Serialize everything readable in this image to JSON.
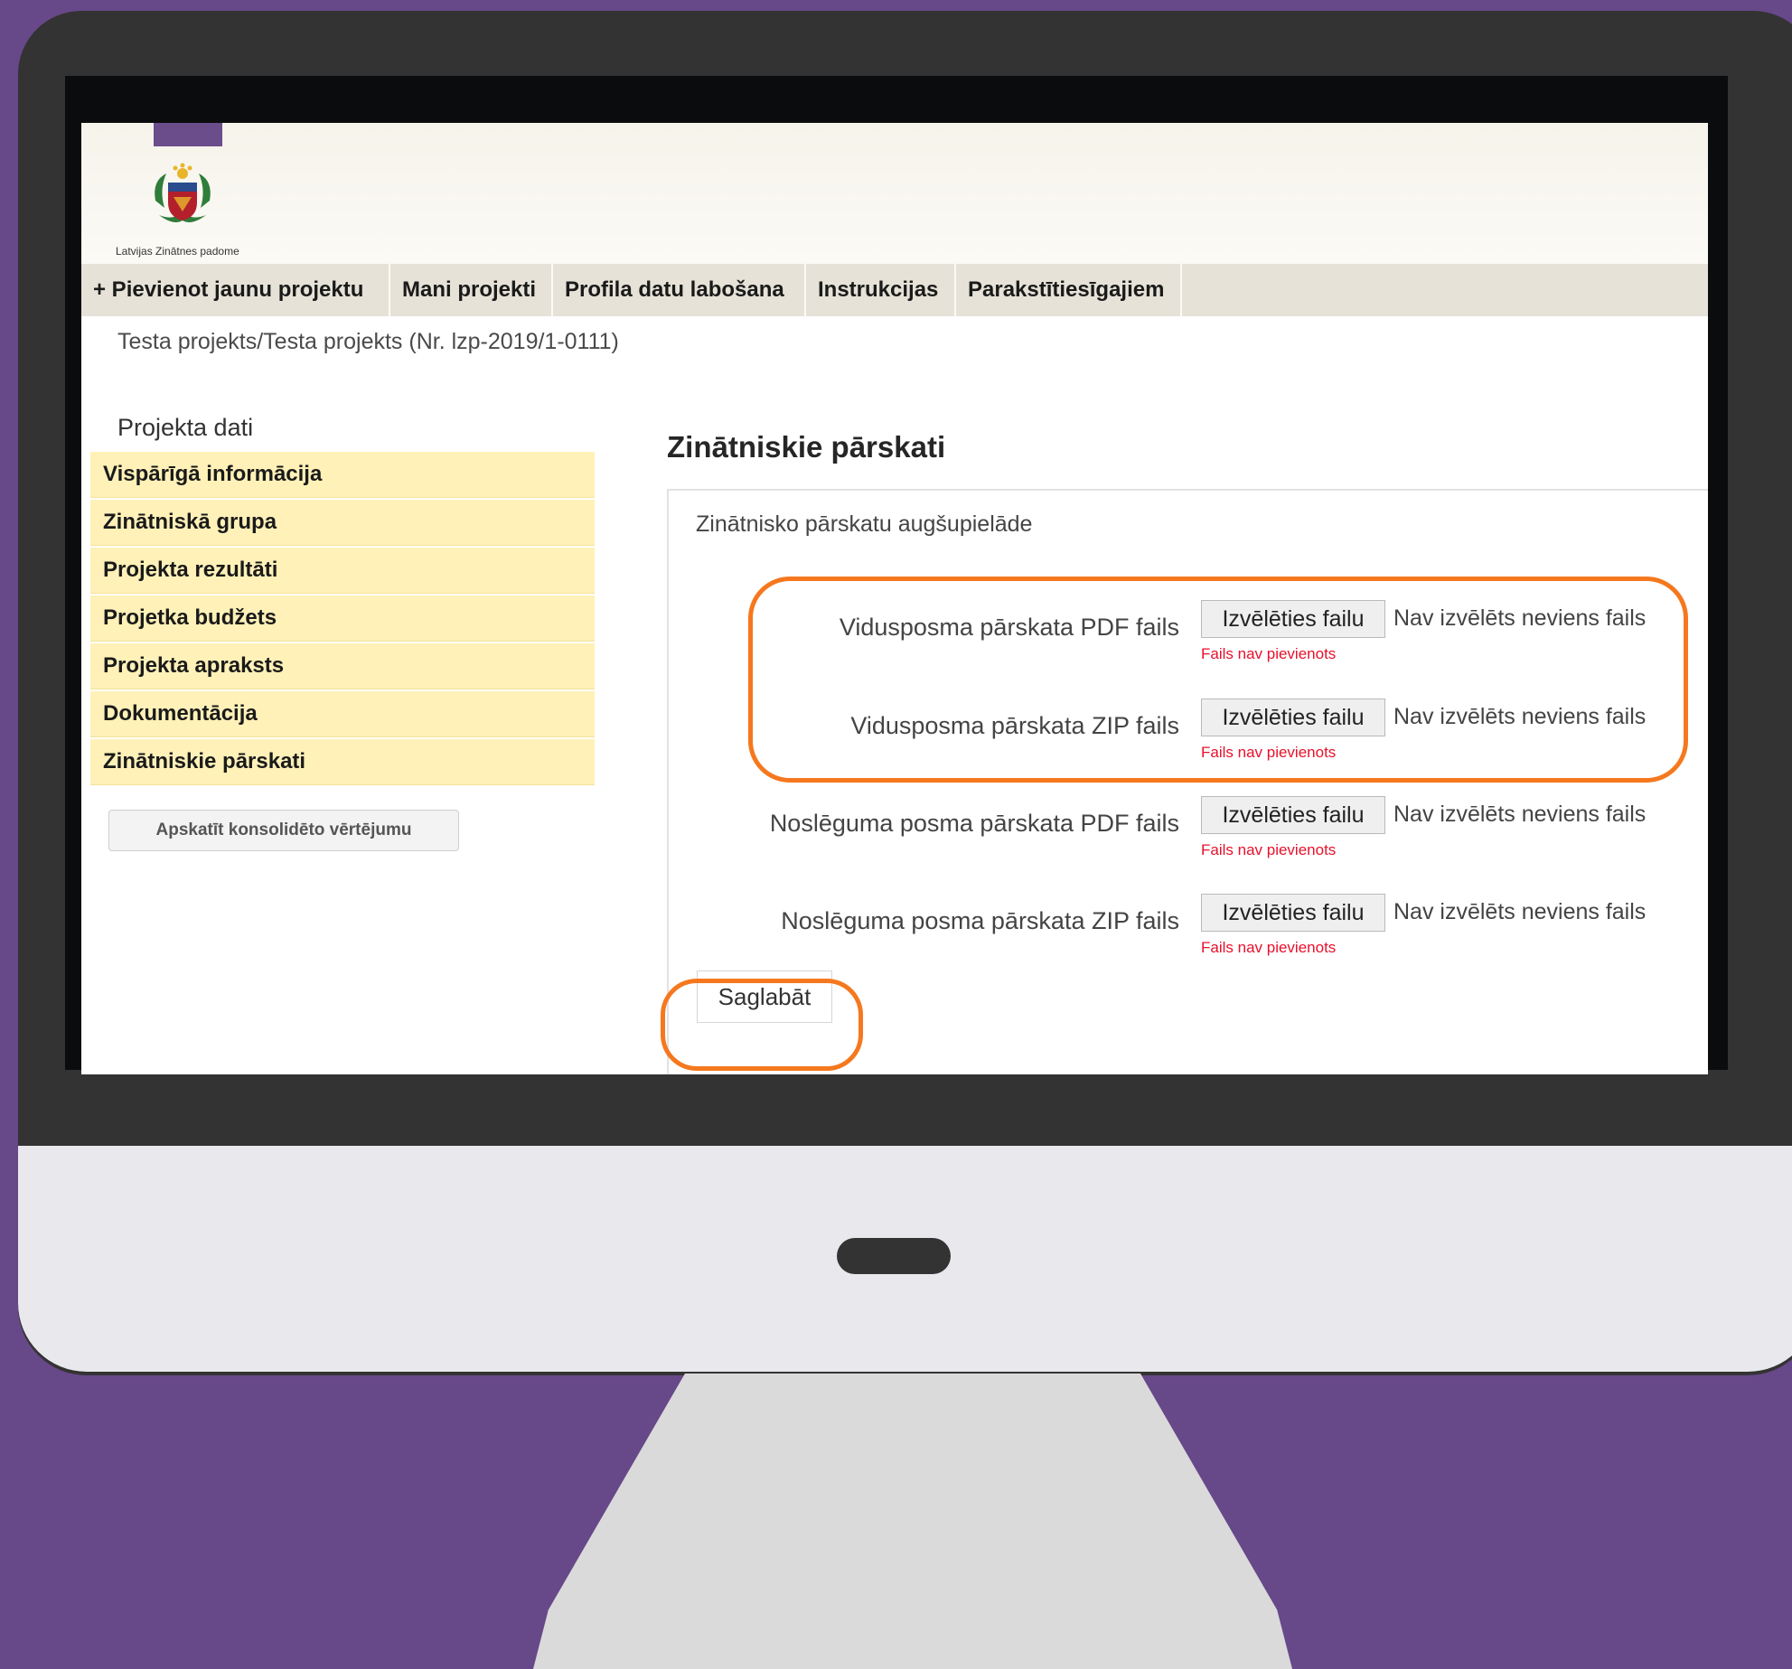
{
  "header": {
    "logo_caption": "Latvijas Zinātnes padome"
  },
  "nav": {
    "items": [
      {
        "label": "+ Pievienot jaunu projektu"
      },
      {
        "label": "Mani projekti"
      },
      {
        "label": "Profila datu labošana"
      },
      {
        "label": "Instrukcijas"
      },
      {
        "label": "Parakstītiesīgajiem"
      }
    ]
  },
  "breadcrumb": "Testa projekts/Testa projekts (Nr. lzp-2019/1-0111)",
  "sidebar": {
    "title": "Projekta dati",
    "items": [
      {
        "label": "Vispārīgā informācija"
      },
      {
        "label": "Zinātniskā grupa"
      },
      {
        "label": "Projekta rezultāti"
      },
      {
        "label": "Projetka budžets"
      },
      {
        "label": "Projekta apraksts"
      },
      {
        "label": "Dokumentācija"
      },
      {
        "label": "Zinātniskie pārskati"
      }
    ],
    "consolidated_button": "Apskatīt konsolidēto vērtējumu"
  },
  "main": {
    "title": "Zinātniskie pārskati",
    "panel_title": "Zinātnisko pārskatu augšupielāde",
    "uploads": [
      {
        "label": "Vidusposma pārskata PDF fails",
        "button": "Izvēlēties failu",
        "status": "Nav izvēlēts neviens fails",
        "error": "Fails nav pievienots"
      },
      {
        "label": "Vidusposma pārskata ZIP fails",
        "button": "Izvēlēties failu",
        "status": "Nav izvēlēts neviens fails",
        "error": "Fails nav pievienots"
      },
      {
        "label": "Noslēguma posma pārskata PDF fails",
        "button": "Izvēlēties failu",
        "status": "Nav izvēlēts neviens fails",
        "error": "Fails nav pievienots"
      },
      {
        "label": "Noslēguma posma pārskata ZIP fails",
        "button": "Izvēlēties failu",
        "status": "Nav izvēlēts neviens fails",
        "error": "Fails nav pievienots"
      }
    ],
    "save_label": "Saglabāt"
  },
  "colors": {
    "background": "#674889",
    "highlight": "#f5781e",
    "sidebar_item": "#fff1b8",
    "error": "#e8102b"
  }
}
